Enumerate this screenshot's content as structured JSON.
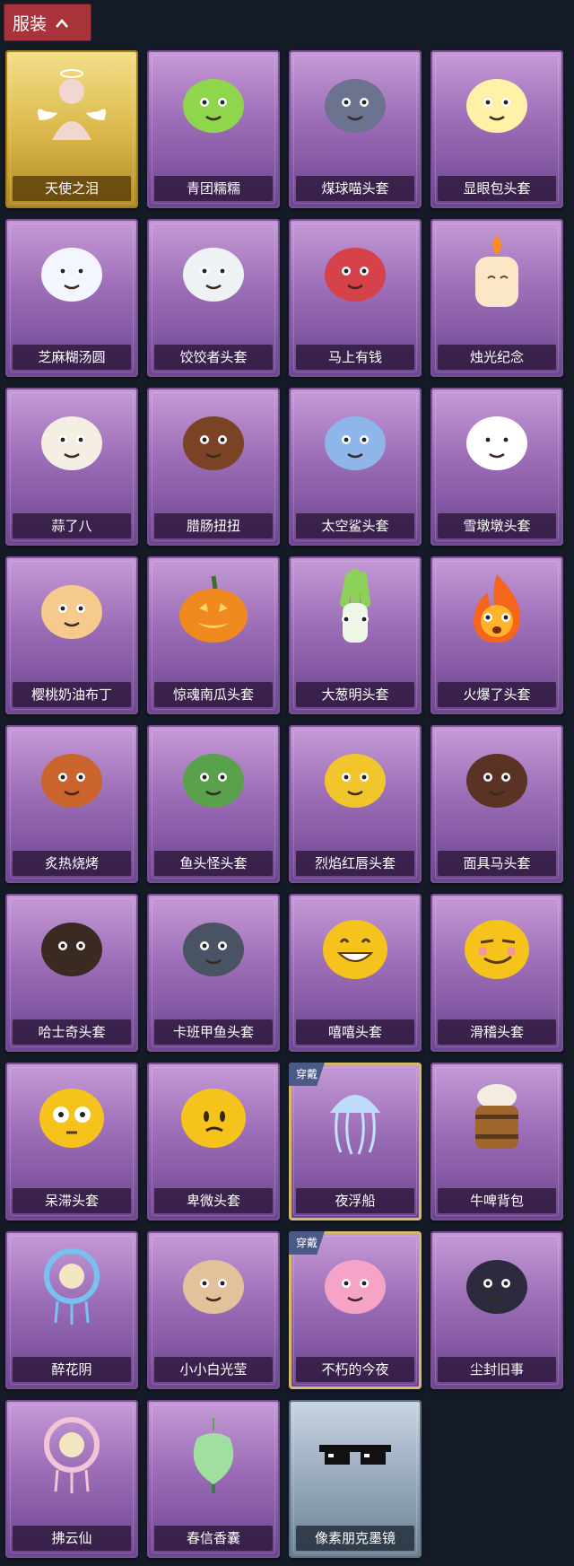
{
  "header": {
    "title": "服装",
    "toggle_icon": "chevron-up-icon"
  },
  "items": [
    {
      "label": "天使之泪",
      "tier": "gold",
      "icon": "angel-mannequin-icon",
      "color": "#f2d7d0",
      "worn": false
    },
    {
      "label": "青团糯糯",
      "tier": "purple",
      "icon": "green-rice-ball-icon",
      "color": "#8fd64c",
      "worn": false
    },
    {
      "label": "煤球喵头套",
      "tier": "purple",
      "icon": "cat-head-icon",
      "color": "#6b7391",
      "worn": false
    },
    {
      "label": "显眼包头套",
      "tier": "purple",
      "icon": "lightbulb-head-icon",
      "color": "#fff1a8",
      "worn": false
    },
    {
      "label": "芝麻糊汤圆",
      "tier": "purple",
      "icon": "rice-dumpling-icon",
      "color": "#f3f6ff",
      "worn": false
    },
    {
      "label": "饺饺者头套",
      "tier": "purple",
      "icon": "dumpling-cloud-icon",
      "color": "#eef2f5",
      "worn": false
    },
    {
      "label": "马上有钱",
      "tier": "purple",
      "icon": "red-horse-icon",
      "color": "#d6424a",
      "worn": false
    },
    {
      "label": "烛光纪念",
      "tier": "purple",
      "icon": "candle-icon",
      "color": "#fbe6c6",
      "worn": false
    },
    {
      "label": "蒜了八",
      "tier": "purple",
      "icon": "garlic-icon",
      "color": "#f5efe3",
      "worn": false
    },
    {
      "label": "腊肠扭扭",
      "tier": "purple",
      "icon": "dachshund-icon",
      "color": "#7a4326",
      "worn": false
    },
    {
      "label": "太空鲨头套",
      "tier": "purple",
      "icon": "shark-head-icon",
      "color": "#8fb6ea",
      "worn": false
    },
    {
      "label": "雪墩墩头套",
      "tier": "purple",
      "icon": "snowman-icon",
      "color": "#ffffff",
      "worn": false
    },
    {
      "label": "樱桃奶油布丁",
      "tier": "purple",
      "icon": "pudding-icon",
      "color": "#f6c98d",
      "worn": false
    },
    {
      "label": "惊魂南瓜头套",
      "tier": "purple",
      "icon": "pumpkin-icon",
      "color": "#f08a1f",
      "worn": false
    },
    {
      "label": "大葱明头套",
      "tier": "purple",
      "icon": "scallion-icon",
      "color": "#8dd15a",
      "worn": false
    },
    {
      "label": "火爆了头套",
      "tier": "purple",
      "icon": "fire-icon",
      "color": "#f5661c",
      "worn": false
    },
    {
      "label": "炙热烧烤",
      "tier": "purple",
      "icon": "bbq-meat-icon",
      "color": "#c9652c",
      "worn": false
    },
    {
      "label": "鱼头怪头套",
      "tier": "purple",
      "icon": "fish-head-icon",
      "color": "#5aa14c",
      "worn": false
    },
    {
      "label": "烈焰红唇头套",
      "tier": "purple",
      "icon": "yellow-mask-icon",
      "color": "#f0c62c",
      "worn": false
    },
    {
      "label": "面具马头套",
      "tier": "purple",
      "icon": "horse-mask-icon",
      "color": "#5b3324",
      "worn": false
    },
    {
      "label": "哈士奇头套",
      "tier": "purple",
      "icon": "dog-sunglasses-icon",
      "color": "#3a2a22",
      "worn": false
    },
    {
      "label": "卡班甲鱼头套",
      "tier": "purple",
      "icon": "whale-head-icon",
      "color": "#4a5364",
      "worn": false
    },
    {
      "label": "嘻嘻头套",
      "tier": "purple",
      "icon": "grin-emoji-icon",
      "color": "#f6c21c",
      "worn": false
    },
    {
      "label": "滑稽头套",
      "tier": "purple",
      "icon": "smirk-emoji-icon",
      "color": "#f6c21c",
      "worn": false
    },
    {
      "label": "呆滞头套",
      "tier": "purple",
      "icon": "stare-emoji-icon",
      "color": "#f6c21c",
      "worn": false
    },
    {
      "label": "卑微头套",
      "tier": "purple",
      "icon": "humble-emoji-icon",
      "color": "#f6c21c",
      "worn": false
    },
    {
      "label": "夜浮船",
      "tier": "purple",
      "icon": "jellyfish-icon",
      "color": "#bfe5ff",
      "worn": true
    },
    {
      "label": "牛啤背包",
      "tier": "purple",
      "icon": "beer-barrel-icon",
      "color": "#a0652c",
      "worn": false
    },
    {
      "label": "醉花阴",
      "tier": "purple",
      "icon": "ornament-icon",
      "color": "#76c2f0",
      "worn": false
    },
    {
      "label": "小小白光莹",
      "tier": "purple",
      "icon": "doll-icon",
      "color": "#e2c29a",
      "worn": false
    },
    {
      "label": "不朽的今夜",
      "tier": "purple",
      "icon": "fox-bowl-icon",
      "color": "#f5a3c6",
      "worn": true
    },
    {
      "label": "尘封旧事",
      "tier": "purple",
      "icon": "chibi-boy-icon",
      "color": "#2b2b3d",
      "worn": false
    },
    {
      "label": "拂云仙",
      "tier": "purple",
      "icon": "fairy-charm-icon",
      "color": "#f3c3d8",
      "worn": false
    },
    {
      "label": "春信香囊",
      "tier": "purple",
      "icon": "sachet-icon",
      "color": "#9fe0a0",
      "worn": false
    },
    {
      "label": "像素朋克墨镜",
      "tier": "grey",
      "icon": "pixel-sunglasses-icon",
      "color": "#111111",
      "worn": false
    }
  ],
  "badge_label": "穿戴"
}
